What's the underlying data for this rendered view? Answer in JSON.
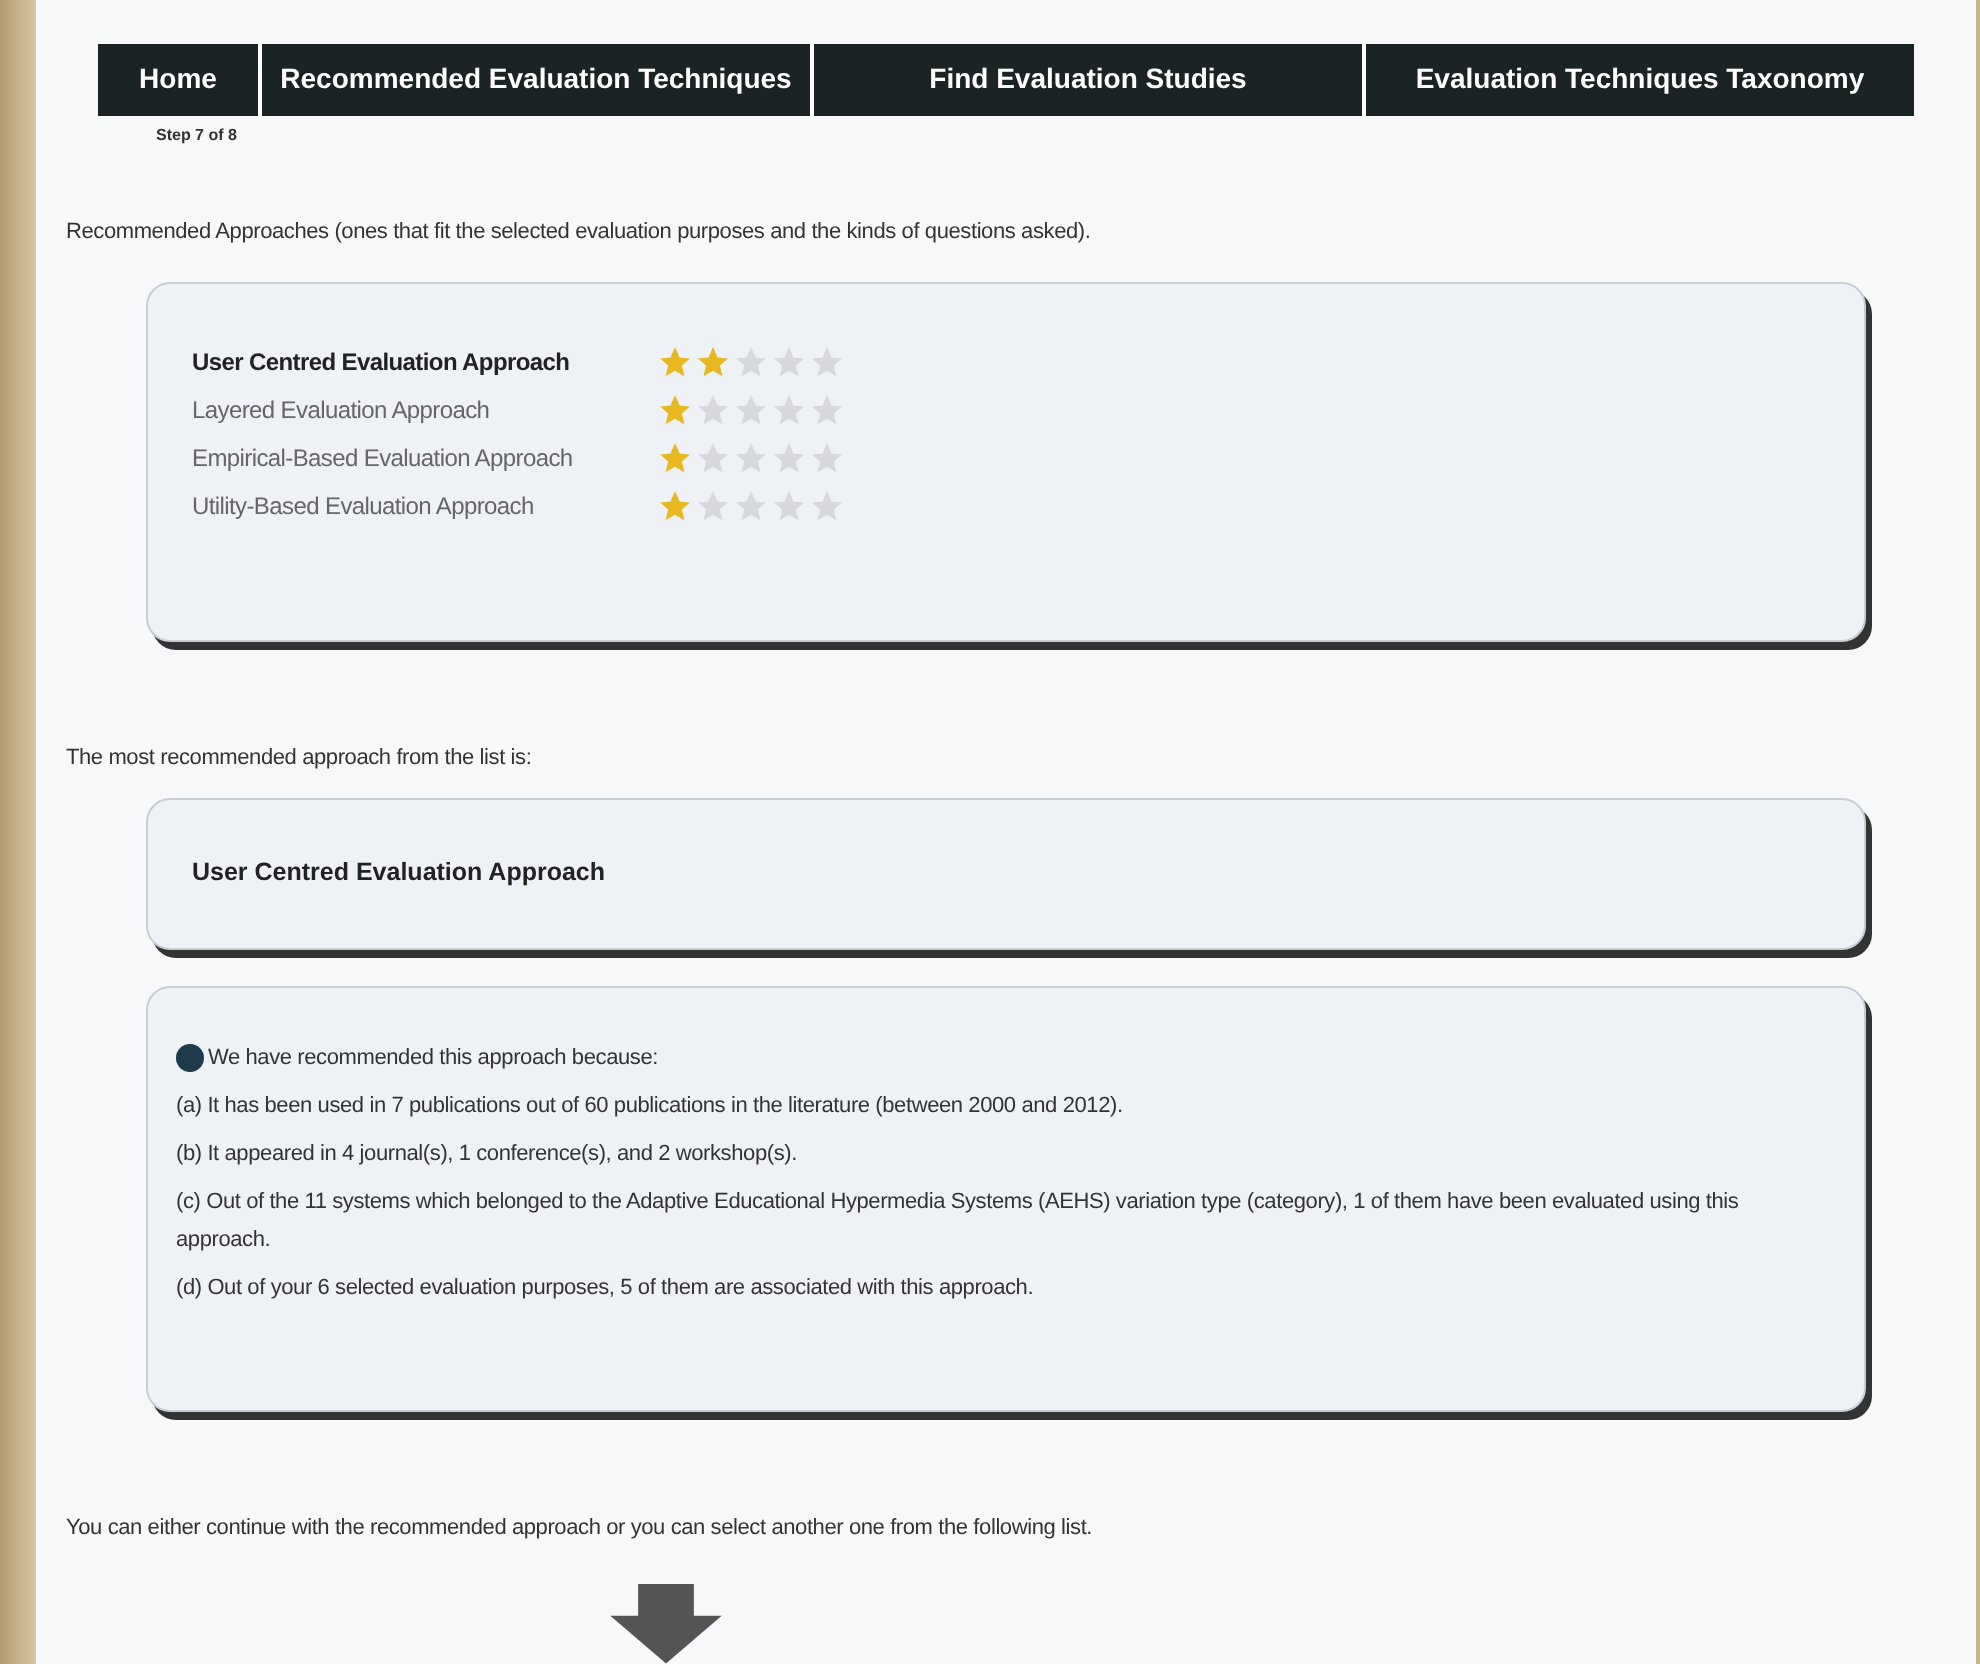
{
  "nav": [
    {
      "label": "Home"
    },
    {
      "label": "Recommended Evaluation Techniques"
    },
    {
      "label": "Find Evaluation Studies"
    },
    {
      "label": "Evaluation Techniques Taxonomy"
    }
  ],
  "step": "Step 7 of 8",
  "intro": "Recommended Approaches (ones that fit the selected evaluation purposes and the kinds of questions asked).",
  "approaches": [
    {
      "name": "User Centred Evaluation Approach",
      "selected": true,
      "stars": 2
    },
    {
      "name": "Layered Evaluation Approach",
      "selected": false,
      "stars": 1
    },
    {
      "name": "Empirical-Based Evaluation Approach",
      "selected": false,
      "stars": 1
    },
    {
      "name": "Utility-Based Evaluation Approach",
      "selected": false,
      "stars": 1
    }
  ],
  "most_label": "The most recommended approach from the list is:",
  "most": "User Centred Evaluation Approach",
  "reasons_title": "We have recommended this approach because:",
  "reasons": [
    "(a) It has been used in 7 publications out of 60 publications in the literature (between 2000 and 2012).",
    "(b) It appeared in 4 journal(s), 1 conference(s), and 2 workshop(s).",
    "(c) Out of the 11 systems which belonged to the Adaptive Educational Hypermedia Systems (AEHS) variation type (category), 1 of them have been evaluated using this approach.",
    "(d) Out of your 6 selected evaluation purposes, 5 of them are associated with this approach."
  ],
  "footer": "You can either continue with the recommended approach or you can select another one from the following list."
}
